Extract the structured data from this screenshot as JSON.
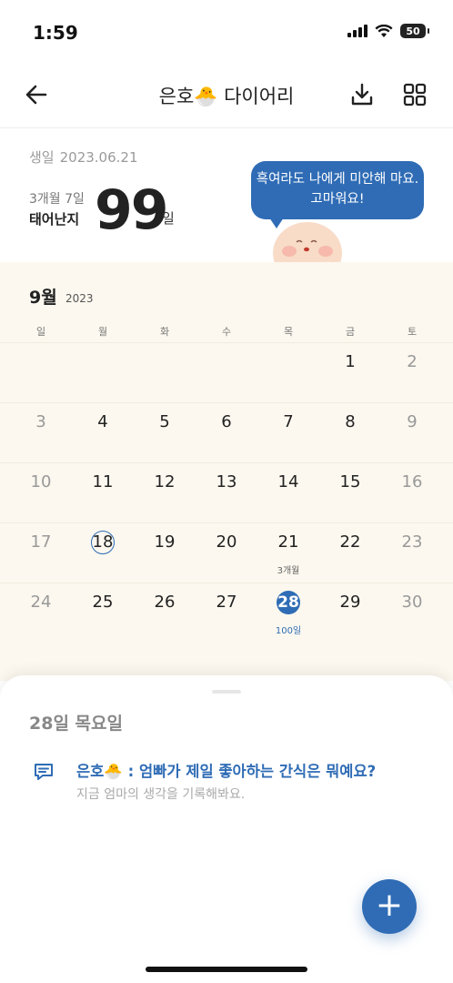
{
  "status": {
    "time": "1:59",
    "battery": "50"
  },
  "header": {
    "title": "은호🐣 다이어리"
  },
  "info": {
    "birth_label": "생일",
    "birth_date": "2023.06.21",
    "age": "3개월 7일",
    "born_label": "태어난지",
    "days": "99",
    "days_unit": "일",
    "bubble": "흑여라도 나에게 미안해 마요. 고마워요!"
  },
  "calendar": {
    "month": "9월",
    "year": "2023",
    "weekdays": [
      "일",
      "월",
      "화",
      "수",
      "목",
      "금",
      "토"
    ],
    "weeks": [
      [
        "",
        "",
        "",
        "",
        "",
        "1",
        "2"
      ],
      [
        "3",
        "4",
        "5",
        "6",
        "7",
        "8",
        "9"
      ],
      [
        "10",
        "11",
        "12",
        "13",
        "14",
        "15",
        "16"
      ],
      [
        "17",
        "18",
        "19",
        "20",
        "21",
        "22",
        "23"
      ],
      [
        "24",
        "25",
        "26",
        "27",
        "28",
        "29",
        "30"
      ]
    ],
    "milestones": {
      "w4_d5": "3개월",
      "w5_d5": "100일"
    }
  },
  "sheet": {
    "title": "28일 목요일",
    "question": "은호🐣 : 엄빠가 제일 좋아하는 간식은 뭐예요?",
    "hint": "지금 엄마의 생각을 기록해봐요."
  },
  "fab": {
    "label": "+"
  },
  "colors": {
    "accent": "#2f6cb5",
    "calendar_bg": "#fcf8ef"
  },
  "icons": {
    "back": "arrow-left-icon",
    "download": "download-icon",
    "grid": "grid-icon",
    "question": "chat-bubble-icon"
  }
}
